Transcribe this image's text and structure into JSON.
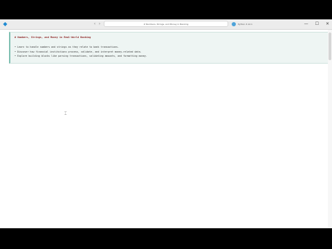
{
  "titlebar": {
    "app_icon": "vscode-icon",
    "command_center_text": "⊘ Numbers, Strings, and Money in Banking",
    "kernel_label": "Python 3.12.1"
  },
  "window_controls": {
    "minimize": "—",
    "maximize": "☐",
    "close": "✕"
  },
  "notebook": {
    "heading": "# Numbers, Strings, and Money in Real-World Banking",
    "bullets": [
      "Learn to handle numbers and strings as they relate to bank transactions.",
      "Discover how financial institutions process, validate, and interpret money-related data.",
      "Explore building blocks like parsing transactions, validating amounts, and formatting money."
    ]
  },
  "colors": {
    "cell_background": "#eef5f3",
    "heading_color": "#8b1f1f",
    "accent": "#1f8ad2"
  }
}
